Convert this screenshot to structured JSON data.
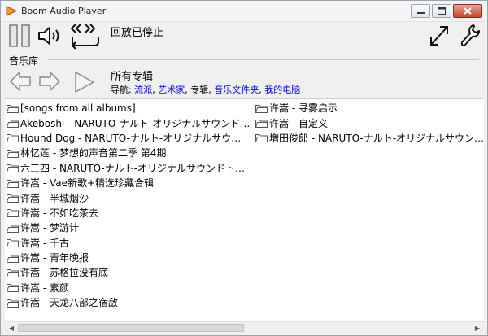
{
  "window": {
    "title": "Boom Audio Player",
    "buttons": {
      "minimize": "▬",
      "maximize": "□",
      "close": "✕"
    }
  },
  "toolbar": {
    "status": "回放已停止",
    "icons": [
      "pause-icon",
      "volume-icon",
      "repeat-icon",
      "fullscreen-icon",
      "settings-wrench-icon"
    ]
  },
  "library": {
    "label": "音乐库",
    "album_title": "所有专辑",
    "breadcrumb": {
      "prefix": "导航: ",
      "items": [
        {
          "label": "流派",
          "link": true
        },
        {
          "label": ", ",
          "link": false
        },
        {
          "label": "艺术家",
          "link": true
        },
        {
          "label": ", 专辑, ",
          "link": false
        },
        {
          "label": "音乐文件夹",
          "link": true
        },
        {
          "label": ", ",
          "link": false
        },
        {
          "label": "我的电脑",
          "link": true
        }
      ]
    }
  },
  "albums_left": [
    "[songs from all albums]",
    "Akeboshi - NARUTO-ナルト-オリジナルサウンドトラック",
    "Hound Dog - NARUTO-ナルト-オリジナルサウンドトラック",
    "林忆莲 - 梦想的声音第二季 第4期",
    "六三四 - NARUTO-ナルト-オリジナルサウンドトラック",
    "许嵩 - Vae新歌+精选珍藏合辑",
    "许嵩 - 半城烟沙",
    "许嵩 - 不如吃茶去",
    "许嵩 - 梦游计",
    "许嵩 - 千古",
    "许嵩 - 青年晚报",
    "许嵩 - 苏格拉没有底",
    "许嵩 - 素颜",
    "许嵩 - 天龙八部之宿敌"
  ],
  "albums_right": [
    "许嵩 - 寻雾启示",
    "许嵩 - 自定义",
    "増田俊郎 - NARUTO-ナルト-オリジナルサウンドトラック"
  ],
  "scrollbar": {
    "left_arrow": "◀",
    "right_arrow": "▶"
  }
}
